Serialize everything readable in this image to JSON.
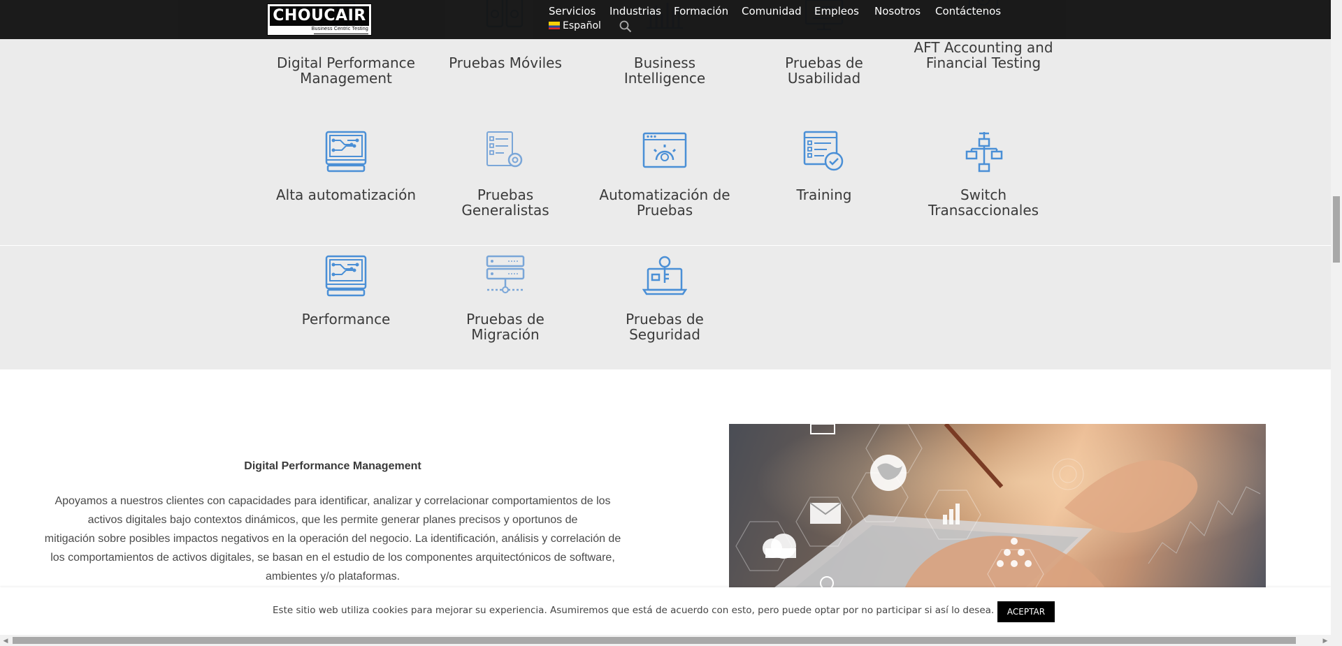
{
  "brand": {
    "name": "CHOUCAIR",
    "tagline": "Business Centric Testing"
  },
  "nav": {
    "items": [
      "Servicios",
      "Industrias",
      "Formación",
      "Comunidad",
      "Empleos",
      "Nosotros",
      "Contáctenos"
    ],
    "language": "Español"
  },
  "services": [
    {
      "label_1": "Digital Performance",
      "label_2": "Management",
      "icon": "cpu-chip-icon"
    },
    {
      "label_1": "Pruebas Móviles",
      "label_2": "",
      "icon": "mobile-devices-icon"
    },
    {
      "label_1": "Business Intelligence",
      "label_2": "",
      "icon": "bar-chart-icon"
    },
    {
      "label_1": "Pruebas de",
      "label_2": "Usabilidad",
      "icon": "monitor-checklist-icon"
    },
    {
      "label_1": "AFT Accounting and",
      "label_2": "Financial Testing",
      "icon": "finance-document-icon"
    },
    {
      "label_1": "Alta automatización",
      "label_2": "",
      "icon": "circuit-monitor-icon"
    },
    {
      "label_1": "Pruebas Generalistas",
      "label_2": "",
      "icon": "checklist-gear-icon"
    },
    {
      "label_1": "Automatización de",
      "label_2": "Pruebas",
      "icon": "browser-gear-icon"
    },
    {
      "label_1": "Training",
      "label_2": "",
      "icon": "checklist-approved-icon"
    },
    {
      "label_1": "Switch",
      "label_2": "Transaccionales",
      "icon": "flowchart-icon"
    },
    {
      "label_1": "Performance",
      "label_2": "",
      "icon": "circuit-monitor-icon"
    },
    {
      "label_1": "Pruebas de Migración",
      "label_2": "",
      "icon": "server-stack-icon"
    },
    {
      "label_1": "Pruebas de",
      "label_2": "Seguridad",
      "icon": "laptop-key-icon"
    }
  ],
  "detail": {
    "title": "Digital Performance Management",
    "lines": [
      "Apoyamos a nuestros clientes con capacidades para identificar, analizar y correlacionar comportamientos de los",
      "activos digitales bajo contextos dinámicos, que les permite generar planes precisos y oportunos de",
      "mitigación sobre posibles impactos negativos en la operación del negocio. La identificación, análisis y correlación de",
      "los comportamientos de activos digitales, se basan en el estudio de los componentes arquitectónicos de software,",
      "ambientes y/o plataformas."
    ]
  },
  "cookie": {
    "message": "Este sitio web utiliza cookies para mejorar su experiencia. Asumiremos que está de acuerdo con esto, pero puede optar por no participar si así lo desea.",
    "accept": "ACEPTAR"
  },
  "colors": {
    "topbar": "#141414",
    "icon_blue": "#4a8fd6",
    "section_gray": "#ebebeb"
  }
}
